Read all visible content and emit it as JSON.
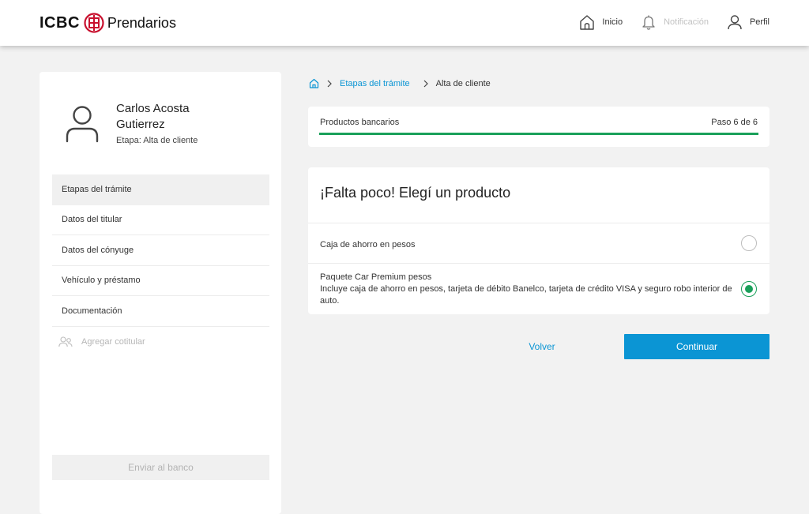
{
  "header": {
    "logo_icbc": "ICBC",
    "logo_mark": "工",
    "logo_brand": "Prendarios",
    "nav": {
      "home": "Inicio",
      "notifications": "Notificación",
      "profile": "Perfil"
    }
  },
  "sidebar": {
    "name_line1": "Carlos Acosta",
    "name_line2": "Gutierrez",
    "stage": "Etapa: Alta de cliente",
    "items": [
      {
        "label": "Etapas del trámite"
      },
      {
        "label": "Datos del titular"
      },
      {
        "label": "Datos del cónyuge"
      },
      {
        "label": "Vehículo y préstamo"
      },
      {
        "label": "Documentación"
      },
      {
        "label": "Agregar cotitular"
      }
    ],
    "send_button": "Enviar al banco"
  },
  "breadcrumb": {
    "link": "Etapas del trámite",
    "current": "Alta de cliente"
  },
  "progress": {
    "label": "Productos bancarios",
    "step_text": "Paso 6 de 6",
    "fraction": 1.0
  },
  "products": {
    "title": "¡Falta poco! Elegí un producto",
    "options": [
      {
        "label": "Caja de ahorro en pesos",
        "selected": false
      },
      {
        "label": "Paquete Car Premium pesos",
        "description": "Incluye caja de ahorro en pesos, tarjeta de débito Banelco, tarjeta de crédito VISA y seguro robo interior de auto.",
        "selected": true
      }
    ]
  },
  "actions": {
    "back": "Volver",
    "continue": "Continuar"
  },
  "colors": {
    "brand_red": "#c8102e",
    "link_blue": "#0b95d4",
    "success_green": "#1aa05a",
    "disabled_gray": "#b3b3b3"
  },
  "icons": [
    "home-icon",
    "bell-icon",
    "user-icon",
    "chevron-right-icon",
    "users-add-icon",
    "radio-selected-icon"
  ]
}
